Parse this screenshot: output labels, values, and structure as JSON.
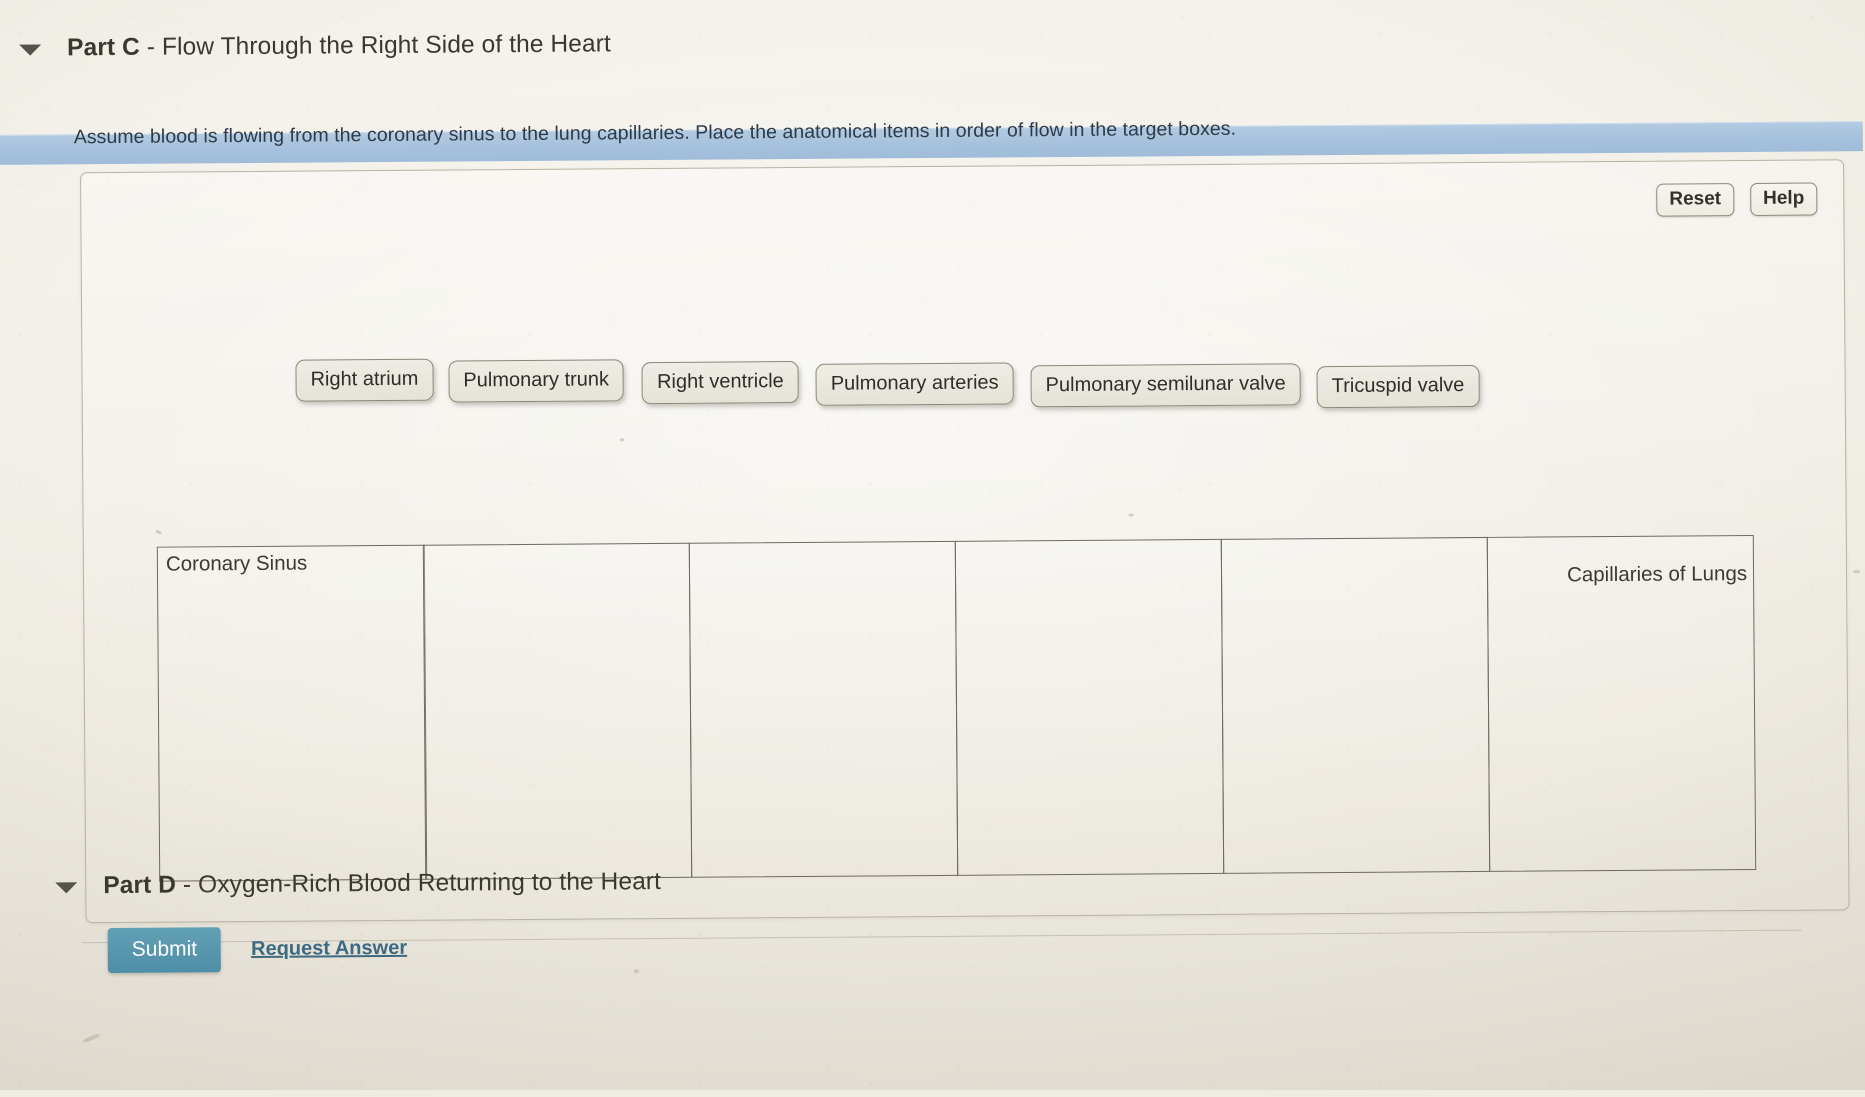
{
  "part_c": {
    "caret_icon": "triangle-down-icon",
    "label": "Part C",
    "separator": " - ",
    "title": "Flow Through the Right Side of the Heart"
  },
  "part_d": {
    "caret_icon": "triangle-down-icon",
    "label": "Part D",
    "separator": " - ",
    "title": "Oxygen-Rich Blood Returning to the Heart"
  },
  "banner": {
    "text": "Assume blood is flowing from the coronary sinus to the lung capillaries. Place the anatomical items in order of flow in the target boxes.",
    "background_color": "#a6c1dd"
  },
  "toolbar": {
    "reset_label": "Reset",
    "help_label": "Help"
  },
  "source_tiles": [
    {
      "label": "Right atrium"
    },
    {
      "label": "Pulmonary trunk"
    },
    {
      "label": "Right ventricle"
    },
    {
      "label": "Pulmonary arteries"
    },
    {
      "label": "Pulmonary semilunar valve"
    },
    {
      "label": "Tricuspid valve"
    }
  ],
  "target_boxes": [
    {
      "label": "Coronary Sinus",
      "align": "left",
      "content": ""
    },
    {
      "label": "",
      "align": "left",
      "content": ""
    },
    {
      "label": "",
      "align": "left",
      "content": ""
    },
    {
      "label": "",
      "align": "left",
      "content": ""
    },
    {
      "label": "",
      "align": "left",
      "content": ""
    },
    {
      "label": "Capillaries of Lungs",
      "align": "right",
      "content": ""
    }
  ],
  "actions": {
    "submit_label": "Submit",
    "submit_color": "#4e8ea6",
    "request_answer_label": "Request Answer"
  }
}
